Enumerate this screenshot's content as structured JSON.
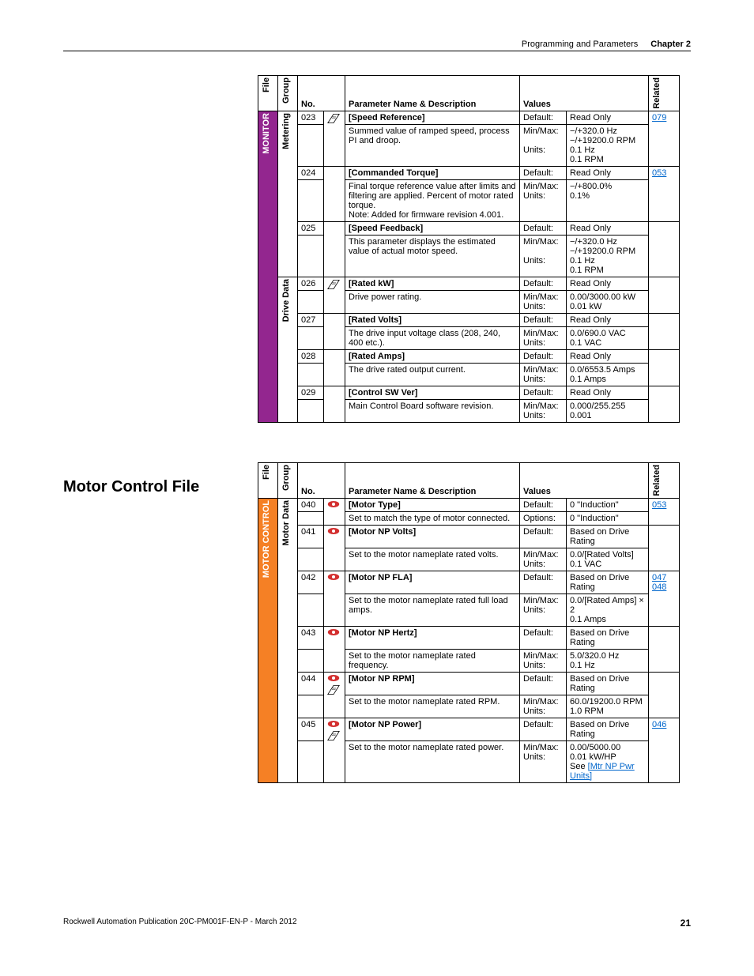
{
  "header": {
    "title": "Programming and Parameters",
    "chapter": "Chapter 2"
  },
  "section2_heading": "Motor Control File",
  "th": {
    "file": "File",
    "group": "Group",
    "no": "No.",
    "param": "Parameter Name & Description",
    "values": "Values",
    "related": "Related"
  },
  "t1": {
    "file": "MONITOR",
    "g1": "Metering",
    "g2": "Drive Data",
    "rows": [
      {
        "no": "023",
        "name": "[Speed Reference]",
        "desc": "Summed value of ramped speed, process PI and droop.",
        "labels": [
          "Default:",
          "Min/Max:",
          "",
          "Units:"
        ],
        "vals": [
          "Read Only",
          "−/+320.0 Hz",
          "−/+19200.0 RPM",
          "0.1 Hz",
          "0.1 RPM"
        ],
        "rel": "079",
        "icons": [
          "32"
        ]
      },
      {
        "no": "024",
        "name": "[Commanded Torque]",
        "desc": "Final torque reference value after limits and filtering are applied. Percent of motor rated torque.\nNote: Added for firmware revision 4.001.",
        "labels": [
          "Default:",
          "Min/Max:",
          "Units:"
        ],
        "vals": [
          "Read Only",
          "−/+800.0%",
          "0.1%"
        ],
        "rel": "053",
        "icons": []
      },
      {
        "no": "025",
        "name": "[Speed Feedback]",
        "desc": "This parameter displays the estimated value of actual motor speed.",
        "labels": [
          "Default:",
          "Min/Max:",
          "",
          "Units:"
        ],
        "vals": [
          "Read Only",
          "−/+320.0 Hz",
          "−/+19200.0 RPM",
          "0.1 Hz",
          "0.1 RPM"
        ],
        "rel": "",
        "icons": []
      },
      {
        "no": "026",
        "name": "[Rated kW]",
        "desc": "Drive power rating.",
        "labels": [
          "Default:",
          "Min/Max:",
          "Units:"
        ],
        "vals": [
          "Read Only",
          "0.00/3000.00 kW",
          "0.01 kW"
        ],
        "rel": "",
        "icons": [
          "32"
        ]
      },
      {
        "no": "027",
        "name": "[Rated Volts]",
        "desc": "The drive input voltage class (208, 240, 400 etc.).",
        "labels": [
          "Default:",
          "Min/Max:",
          "Units:"
        ],
        "vals": [
          "Read Only",
          "0.0/690.0 VAC",
          "0.1 VAC"
        ],
        "rel": "",
        "icons": []
      },
      {
        "no": "028",
        "name": "[Rated Amps]",
        "desc": "The drive rated output current.",
        "labels": [
          "Default:",
          "Min/Max:",
          "Units:"
        ],
        "vals": [
          "Read Only",
          "0.0/6553.5 Amps",
          "0.1 Amps"
        ],
        "rel": "",
        "icons": []
      },
      {
        "no": "029",
        "name": "[Control SW Ver]",
        "desc": "Main Control Board software revision.",
        "labels": [
          "Default:",
          "Min/Max:",
          "Units:"
        ],
        "vals": [
          "Read Only",
          "0.000/255.255",
          "0.001"
        ],
        "rel": "",
        "icons": []
      }
    ]
  },
  "t2": {
    "file": "MOTOR CONTROL",
    "g1": "Motor Data",
    "rows": [
      {
        "no": "040",
        "name": "[Motor Type]",
        "desc": "Set to match the type of motor connected.",
        "labels": [
          "Default:",
          "Options:"
        ],
        "vals": [
          "0   \"Induction\"",
          "0   \"Induction\""
        ],
        "rel": "053",
        "icons": [
          "eye"
        ]
      },
      {
        "no": "041",
        "name": "[Motor NP Volts]",
        "desc": "Set to the motor nameplate rated volts.",
        "labels": [
          "Default:",
          "Min/Max:",
          "Units:"
        ],
        "vals": [
          "Based on Drive Rating",
          "0.0/[Rated Volts]",
          "0.1 VAC"
        ],
        "rel": "",
        "icons": [
          "eye"
        ]
      },
      {
        "no": "042",
        "name": "[Motor NP FLA]",
        "desc": "Set to the motor nameplate rated full load amps.",
        "labels": [
          "Default:",
          "Min/Max:",
          "Units:"
        ],
        "vals": [
          "Based on Drive Rating",
          "0.0/[Rated Amps] × 2",
          "0.1 Amps"
        ],
        "rel": "047 048",
        "icons": [
          "eye"
        ]
      },
      {
        "no": "043",
        "name": "[Motor NP Hertz]",
        "desc": "Set to the motor nameplate rated frequency.",
        "labels": [
          "Default:",
          "Min/Max:",
          "Units:"
        ],
        "vals": [
          "Based on Drive Rating",
          "5.0/320.0 Hz",
          "0.1 Hz"
        ],
        "rel": "",
        "icons": [
          "eye"
        ]
      },
      {
        "no": "044",
        "name": "[Motor NP RPM]",
        "desc": "Set to the motor nameplate rated RPM.",
        "labels": [
          "Default:",
          "Min/Max:",
          "Units:"
        ],
        "vals": [
          "Based on Drive Rating",
          "60.0/19200.0 RPM",
          "1.0 RPM"
        ],
        "rel": "",
        "icons": [
          "eye",
          "32"
        ]
      },
      {
        "no": "045",
        "name": "[Motor NP Power]",
        "desc": "Set to the motor nameplate rated power.",
        "labels": [
          "Default:",
          "Min/Max:",
          "Units:"
        ],
        "vals": [
          "Based on Drive Rating",
          "0.00/5000.00",
          "0.01 kW/HP",
          "See [Mtr NP Pwr Units]"
        ],
        "rel": "046",
        "icons": [
          "eye",
          "32"
        ]
      }
    ]
  },
  "footer": {
    "pub": "Rockwell Automation Publication 20C-PM001F-EN-P - March 2012",
    "page": "21"
  }
}
